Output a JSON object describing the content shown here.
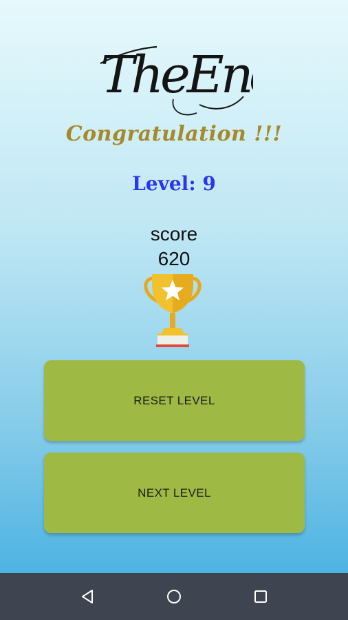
{
  "header": {
    "logo_text": "TheEnd",
    "congrats": "Congratulation !!!"
  },
  "level": {
    "label": "Level:",
    "value": "9"
  },
  "score": {
    "label": "score",
    "value": "620"
  },
  "buttons": {
    "reset": "RESET LEVEL",
    "next": "NEXT LEVEL"
  },
  "icons": {
    "trophy": "trophy-icon",
    "back": "back-triangle-icon",
    "home": "home-circle-icon",
    "recent": "recent-square-icon"
  },
  "colors": {
    "congrats": "#a6892a",
    "level": "#2a36f0",
    "button": "#9fba44",
    "navbar": "#3f4550",
    "trophy_gold": "#f2c12e",
    "trophy_base_stripe": "#e04a36"
  }
}
